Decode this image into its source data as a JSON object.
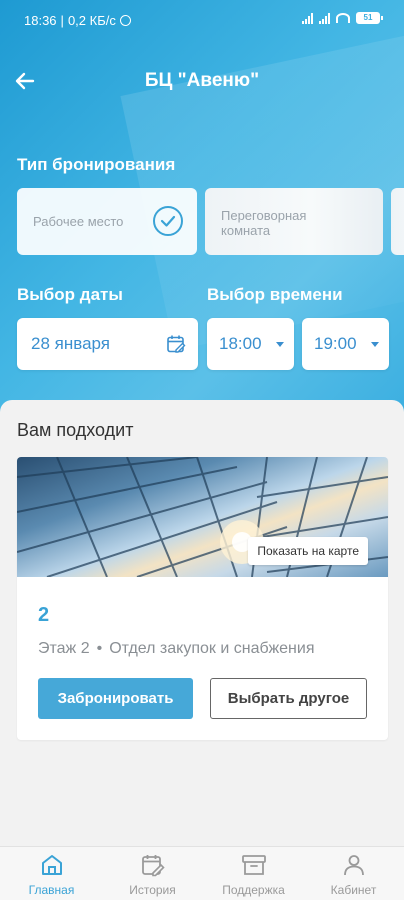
{
  "status_bar": {
    "time": "18:36",
    "network_speed": "0,2 КБ/с",
    "battery": "51"
  },
  "header": {
    "title": "БЦ \"Авеню\""
  },
  "booking_type": {
    "label": "Тип бронирования",
    "options": [
      {
        "label": "Рабочее место",
        "selected": true
      },
      {
        "label": "Переговорная комната",
        "selected": false
      },
      {
        "label": "",
        "selected": false
      }
    ]
  },
  "date": {
    "label": "Выбор даты",
    "value": "28 января"
  },
  "time": {
    "label": "Выбор времени",
    "from": "18:00",
    "to": "19:00"
  },
  "result": {
    "title": "Вам подходит",
    "map_button": "Показать на карте",
    "place_number": "2",
    "floor": "Этаж 2",
    "separator": "•",
    "department": "Отдел закупок и снабжения",
    "book_button": "Забронировать",
    "choose_other_button": "Выбрать другое"
  },
  "bottom_nav": [
    {
      "label": "Главная",
      "icon": "home-icon",
      "active": true
    },
    {
      "label": "История",
      "icon": "history-icon",
      "active": false
    },
    {
      "label": "Поддержка",
      "icon": "support-icon",
      "active": false
    },
    {
      "label": "Кабинет",
      "icon": "profile-icon",
      "active": false
    }
  ],
  "colors": {
    "accent": "#3aa3d6",
    "hero_gradient_start": "#1e9ad2",
    "hero_gradient_end": "#5bc0e8"
  }
}
